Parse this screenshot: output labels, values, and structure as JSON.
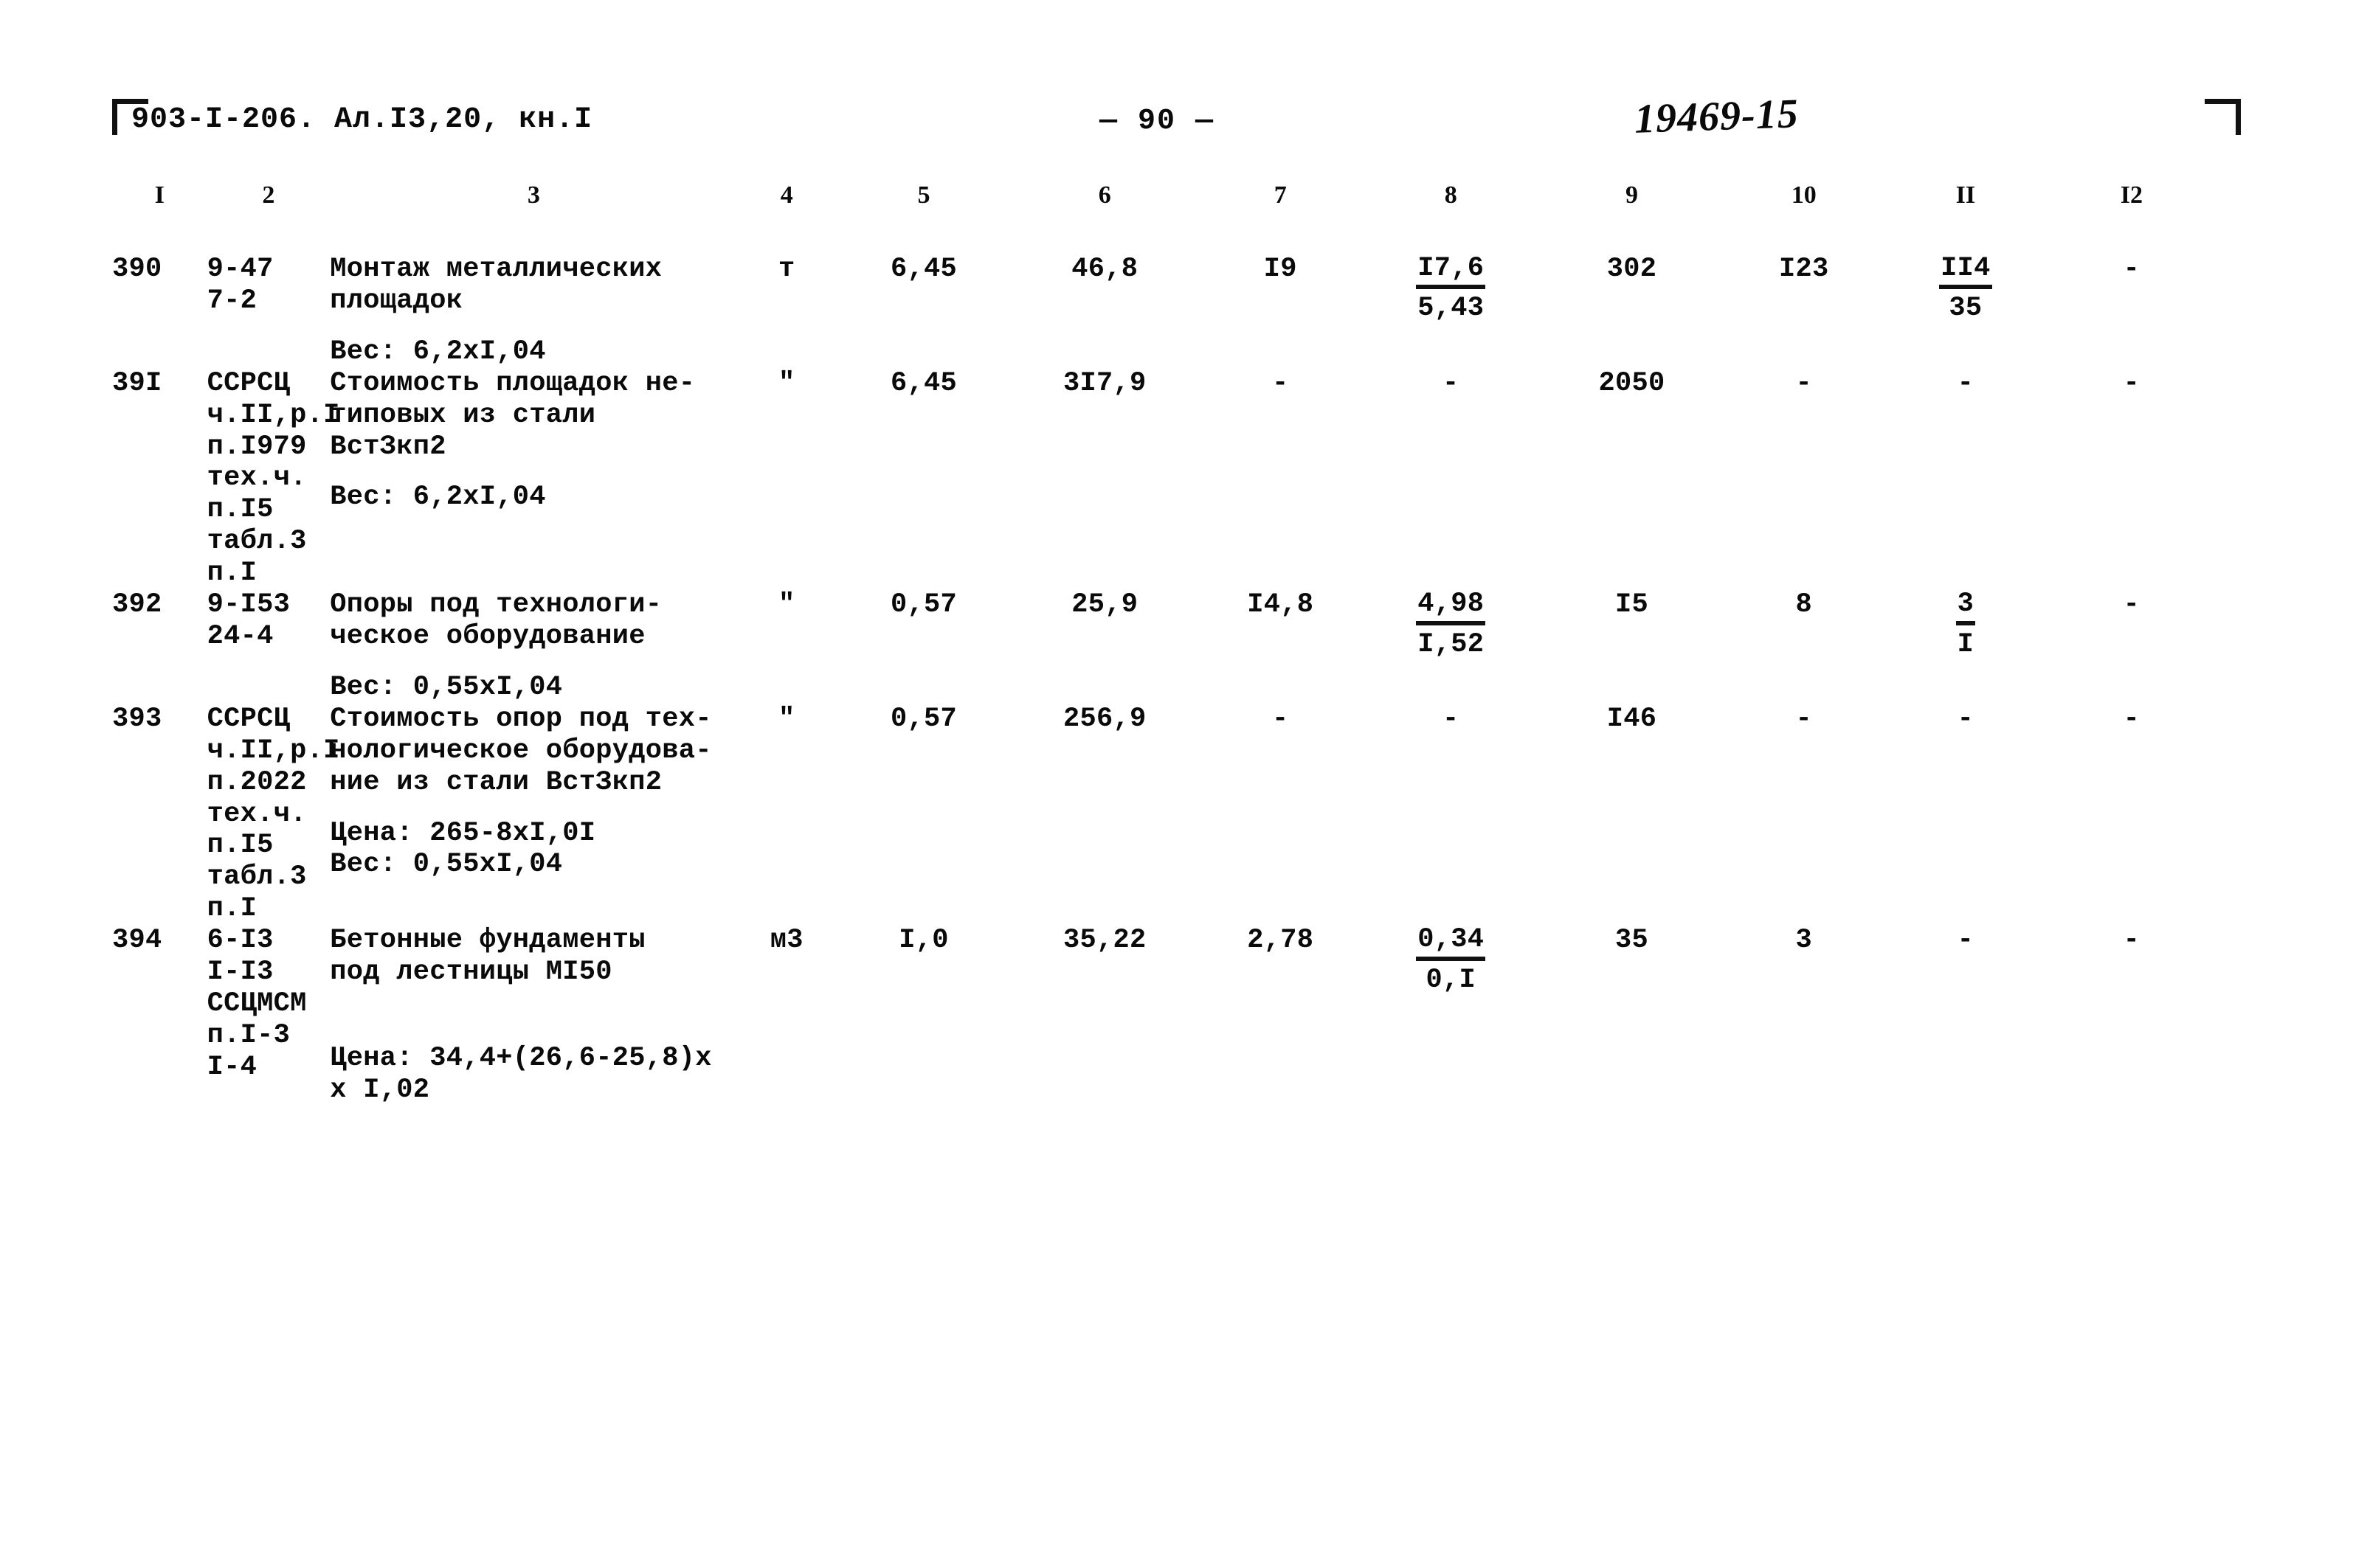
{
  "header": {
    "doc_code": "903-I-206. Ал.I3,20, кн.I",
    "page_number": "— 90 —",
    "order_number": "19469-15"
  },
  "table": {
    "column_headers": [
      "I",
      "2",
      "3",
      "4",
      "5",
      "6",
      "7",
      "8",
      "9",
      "10",
      "II",
      "I2"
    ],
    "rows": [
      {
        "num": "390",
        "code": "9-47\n7-2",
        "desc": "Монтаж металлических\nплощадок",
        "desc_extra": "Вес: 6,2хI,04",
        "desc_extra2": "",
        "unit": "т",
        "c5": "6,45",
        "c6": "46,8",
        "c7": "I9",
        "c8_top": "I7,6",
        "c8_bot": "5,43",
        "c9": "302",
        "c10": "I23",
        "c11_top": "II4",
        "c11_bot": "35",
        "c12": "-"
      },
      {
        "num": "39I",
        "code": "ССРСЦ\nч.II,р.I\nп.I979\nтех.ч.\nп.I5\nтабл.3\nп.I",
        "desc": "Стоимость площадок не-\nтиповых из  стали\nВстЗкп2",
        "desc_extra": "Вес: 6,2хI,04",
        "desc_extra2": "",
        "unit": "\"",
        "c5": "6,45",
        "c6": "3I7,9",
        "c7": "-",
        "c8_top": "-",
        "c8_bot": "",
        "c9": "2050",
        "c10": "-",
        "c11_top": "-",
        "c11_bot": "",
        "c12": "-"
      },
      {
        "num": "392",
        "code": "9-I53\n24-4",
        "desc": "Опоры под технологи-\nческое оборудование",
        "desc_extra": "Вес: 0,55хI,04",
        "desc_extra2": "",
        "unit": "\"",
        "c5": "0,57",
        "c6": "25,9",
        "c7": "I4,8",
        "c8_top": "4,98",
        "c8_bot": "I,52",
        "c9": "I5",
        "c10": "8",
        "c11_top": "3",
        "c11_bot": "I",
        "c12": "-"
      },
      {
        "num": "393",
        "code": "ССРСЦ\nч.II,р.I\nп.2022\nтех.ч.\nп.I5\nтабл.3\nп.I",
        "desc": "Стоимость опор под тех-\nнологическое оборудова-\nние из стали ВстЗкп2",
        "desc_extra": "Цена: 265-8хI,0I\nВес: 0,55хI,04",
        "desc_extra2": "",
        "unit": "\"",
        "c5": "0,57",
        "c6": "256,9",
        "c7": "-",
        "c8_top": "-",
        "c8_bot": "",
        "c9": "I46",
        "c10": "-",
        "c11_top": "-",
        "c11_bot": "",
        "c12": "-"
      },
      {
        "num": "394",
        "code": "6-I3\nI-I3\nССЦМСМ\nп.I-3\nI-4",
        "desc": "Бетонные фундаменты\n под лестницы МI50",
        "desc_extra": "",
        "desc_extra2": "Цена: 34,4+(26,6-25,8)х\n х I,02",
        "unit": "м3",
        "c5": "I,0",
        "c6": "35,22",
        "c7": "2,78",
        "c8_top": "0,34",
        "c8_bot": "0,I",
        "c9": "35",
        "c10": "3",
        "c11_top": "-",
        "c11_bot": "",
        "c12": "-"
      }
    ]
  }
}
